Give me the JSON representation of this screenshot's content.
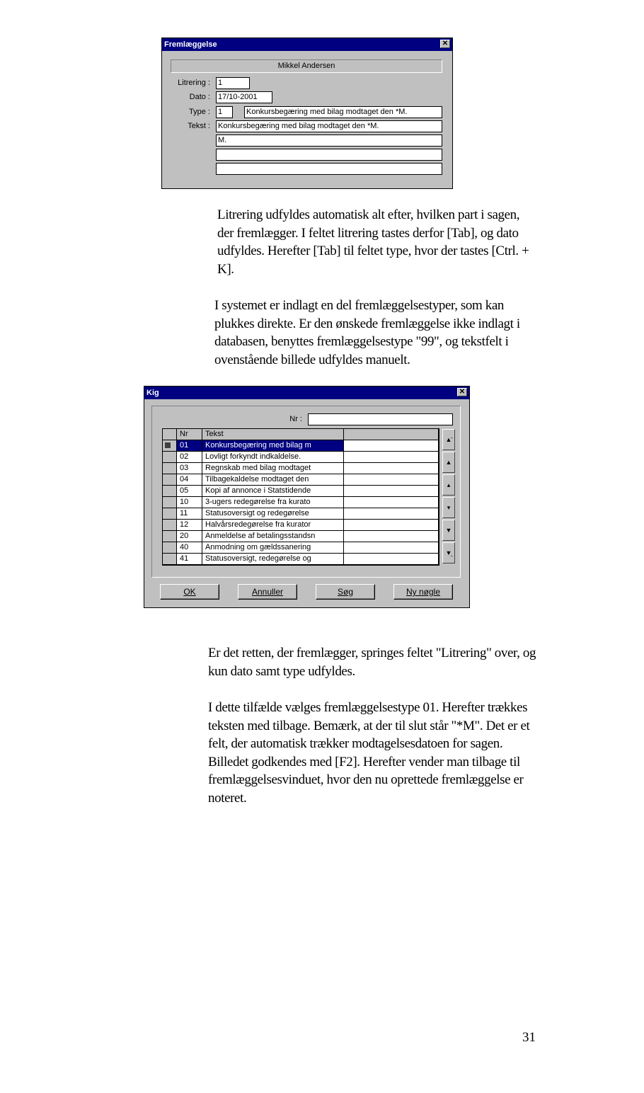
{
  "dialog1": {
    "title": "Fremlæggelse",
    "party_name": "Mikkel Andersen",
    "labels": {
      "litrering": "Litrering :",
      "dato": "Dato :",
      "type": "Type :",
      "tekst": "Tekst :"
    },
    "values": {
      "litrering": "1",
      "dato": "17/10-2001",
      "type_nr": "1",
      "type_text": "Konkursbegæring med bilag modtaget den *M.",
      "tekst_lines": [
        "Konkursbegæring med bilag modtaget den *M.",
        "M.",
        "",
        ""
      ]
    }
  },
  "para1": "Litrering udfyldes automatisk alt efter, hvilken part i sagen, der fremlægger. I feltet litrering tastes derfor [Tab], og dato udfyldes. Herefter [Tab] til feltet type, hvor der tastes [Ctrl. + K].",
  "para2": "I systemet er indlagt en del fremlæggelsestyper, som kan plukkes direkte. Er den ønskede fremlæggelse ikke indlagt i databasen, benyttes fremlæggelsestype \"99\", og tekstfelt i ovenstående billede udfyldes manuelt.",
  "dialog2": {
    "title": "Kig",
    "nr_label": "Nr :",
    "nr_value": "",
    "columns": [
      "Nr",
      "Tekst"
    ],
    "rows": [
      {
        "nr": "01",
        "text": "Konkursbegæring med bilag m",
        "selected": true
      },
      {
        "nr": "02",
        "text": "Lovligt forkyndt indkaldelse."
      },
      {
        "nr": "03",
        "text": "Regnskab med bilag modtaget"
      },
      {
        "nr": "04",
        "text": "Tilbagekaldelse modtaget den"
      },
      {
        "nr": "05",
        "text": "Kopi af annonce i Statstidende"
      },
      {
        "nr": "10",
        "text": "3-ugers redegørelse fra kurato"
      },
      {
        "nr": "11",
        "text": "Statusoversigt og redegørelse"
      },
      {
        "nr": "12",
        "text": "Halvårsredegørelse fra kurator"
      },
      {
        "nr": "20",
        "text": "Anmeldelse af betalingsstandsn"
      },
      {
        "nr": "40",
        "text": "Anmodning om gældssanering"
      },
      {
        "nr": "41",
        "text": "Statusoversigt, redegørelse og"
      }
    ],
    "nav_icons": [
      "first-page-icon",
      "page-up-icon",
      "prev-row-icon",
      "next-row-icon",
      "page-down-icon",
      "last-page-icon"
    ],
    "buttons": {
      "ok": "OK",
      "annuller": "Annuller",
      "soeg": "Søg",
      "ny": "Ny nøgle"
    }
  },
  "para3": "Er det retten, der fremlægger,  springes feltet \"Litrering\" over, og kun dato samt type udfyldes.",
  "para4": "I dette tilfælde vælges fremlæggelsestype 01. Herefter trækkes teksten med tilbage. Bemærk, at der til slut står \"*M\". Det er et felt, der automatisk trækker modtagelsesdatoen for sagen. Billedet godkendes med [F2]. Herefter vender man tilbage til fremlæggelsesvinduet, hvor den nu oprettede fremlæggelse er noteret.",
  "page_number": "31"
}
